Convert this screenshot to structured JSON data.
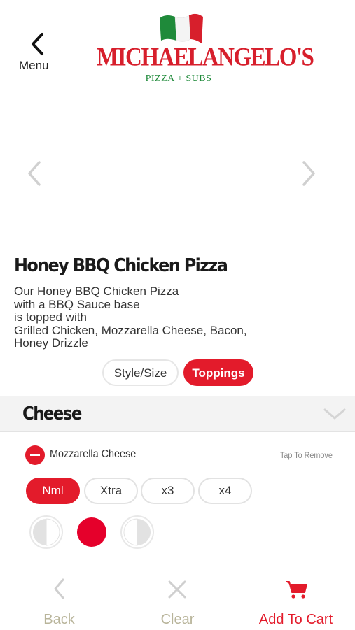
{
  "header": {
    "back_label": "Menu",
    "logo": {
      "wordmark": "MICHAELANGELO'S",
      "tagline": "PIZZA + SUBS"
    }
  },
  "product": {
    "title": "Honey BBQ Chicken Pizza",
    "description_lines": [
      "Our Honey BBQ Chicken Pizza",
      "with a BBQ Sauce base",
      "is topped with",
      "Grilled Chicken, Mozzarella Cheese, Bacon,",
      "Honey Drizzle"
    ]
  },
  "tabs": [
    {
      "label": "Style/Size",
      "selected": false
    },
    {
      "label": "Toppings",
      "selected": true
    }
  ],
  "section": {
    "title": "Cheese"
  },
  "topping": {
    "name": "Mozzarella Cheese",
    "remove_hint": "Tap To Remove",
    "amounts": [
      "Nml",
      "Xtra",
      "x3",
      "x4"
    ],
    "selected_amount": "Nml",
    "portion_selected": "whole"
  },
  "bottom_bar": {
    "back_label": "Back",
    "clear_label": "Clear",
    "cart_label": "Add To Cart"
  },
  "colors": {
    "accent": "#e31b2b",
    "inactive_label": "#b8b49a",
    "section_bg": "#f3f3f3",
    "logo_red": "#d71f2c",
    "logo_green": "#1f8a3a"
  },
  "icons": {
    "back": "chevron-left-icon",
    "prev": "chevron-left-icon",
    "next": "chevron-right-icon",
    "section_toggle": "chevron-down-icon",
    "remove": "minus-circle-icon",
    "clear": "close-icon",
    "cart": "cart-icon"
  }
}
